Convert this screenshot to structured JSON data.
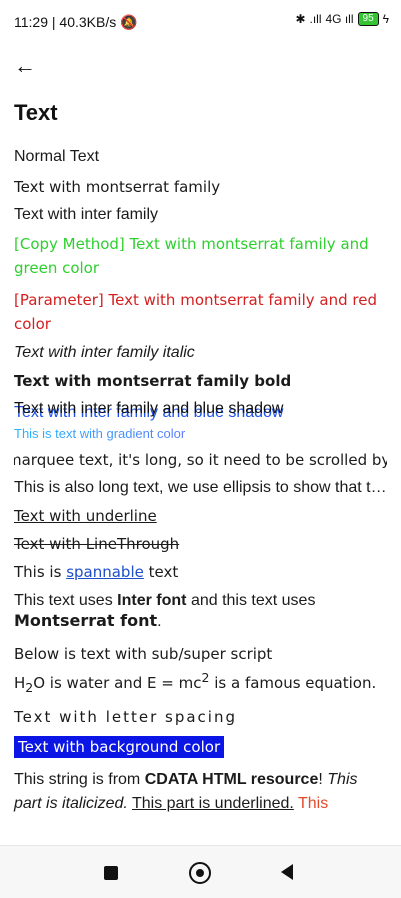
{
  "status": {
    "time_speed": "11:29 | 40.3KB/s",
    "mute_icon": "bell-off-icon",
    "bluetooth_icon": "bluetooth-icon",
    "signal1": ".ıll",
    "signal2": "4G ıll",
    "battery": "95",
    "charging_icon": "bolt-icon"
  },
  "header": {
    "back_icon": "arrow-left-icon",
    "title": "Text"
  },
  "items": {
    "normal": "Normal Text",
    "montserrat": "Text with montserrat family",
    "inter": "Text with inter family",
    "green": "[Copy Method] Text with montserrat family and green color",
    "red": "[Parameter] Text with montserrat family and red color",
    "italic": "Text with inter family italic",
    "bold": "Text with montserrat family bold",
    "shadow": "Text with inter family and blue shadow",
    "gradient": "This is text with gradient color",
    "marquee": "marquee text, it's long, so it need to be scrolled by",
    "ellipsis": "This is also long text, we use ellipsis to show that the text is cut off",
    "underline": "Text with underline",
    "linethrough": "Text with LineThrough",
    "spannable_prefix": "This is",
    "spannable_link": "spannable",
    "spannable_suffix": "text",
    "inter_font_1": "This text uses",
    "inter_font_bold": "Inter font",
    "inter_font_2": "and this text uses",
    "montserrat_bold": "Montserrat font",
    "period": ".",
    "subsup_title": "Below is text with sub/super script",
    "water_h": "H",
    "water_sub": "2",
    "water_rest": "O is water and E = mc",
    "sup": "2",
    "famous": "is a famous equation.",
    "letter_spacing": "Text with letter spacing",
    "background": "Text with background color",
    "cdata_1": "This string is from",
    "cdata_bold": "CDATA HTML resource",
    "cdata_2": "!",
    "cdata_italic": "This part is italicized.",
    "cdata_underline": "This part is underlined.",
    "cdata_red": "This"
  },
  "colors": {
    "green": "#2fcf2f",
    "red": "#d32020",
    "shadow_blue": "#1e52e6",
    "background_blue": "#0b16e6"
  },
  "nav": {
    "recents_icon": "square-icon",
    "home_icon": "circle-icon",
    "back_icon": "triangle-back-icon"
  }
}
